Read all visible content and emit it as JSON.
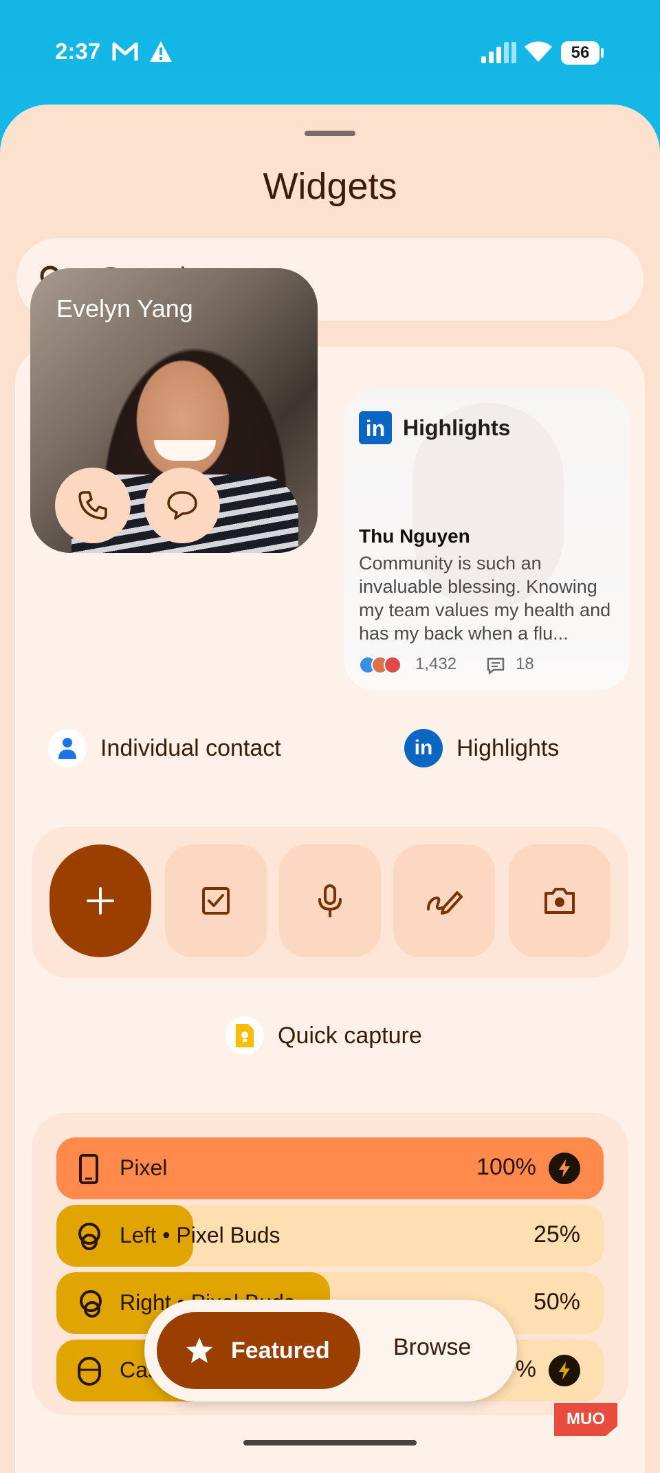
{
  "status_bar": {
    "time": "2:37",
    "battery": "56",
    "icons": [
      "gmail-icon",
      "alert-icon",
      "signal-icon",
      "wifi-icon",
      "battery-icon"
    ]
  },
  "sheet": {
    "title": "Widgets",
    "search": {
      "placeholder": "Search",
      "icon": "search-icon"
    }
  },
  "widgets": {
    "contact": {
      "name": "Evelyn Yang",
      "caption": "Individual contact",
      "actions": [
        "phone-icon",
        "message-icon"
      ]
    },
    "linkedin": {
      "logo": "in",
      "header": "Highlights",
      "author": "Thu Nguyen",
      "post": "Community is such an invaluable blessing. Knowing my team values my health and has my back when a flu...",
      "reactions": "1,432",
      "comments": "18",
      "caption": "Highlights"
    },
    "quick_capture": {
      "caption": "Quick capture",
      "buttons": [
        "add-icon",
        "checkbox-icon",
        "mic-icon",
        "draw-icon",
        "camera-icon"
      ]
    },
    "batteries": [
      {
        "label": "Pixel",
        "percent": "100%",
        "level": 1.0,
        "charging": true,
        "icon": "phone-icon"
      },
      {
        "label": "Left • Pixel Buds",
        "percent": "25%",
        "level": 0.25,
        "charging": false,
        "icon": "earbud-icon"
      },
      {
        "label": "Right • Pixel Buds",
        "percent": "50%",
        "level": 0.5,
        "charging": false,
        "icon": "earbud-icon"
      },
      {
        "label": "Case",
        "percent": "%",
        "level": 0.65,
        "charging": true,
        "icon": "case-icon"
      }
    ]
  },
  "tabs": {
    "featured": "Featured",
    "browse": "Browse"
  },
  "watermark": "MUO",
  "colors": {
    "accent": "#9b3f00",
    "sheet": "#fde1cf",
    "pixel_bar": "#ff8a4c",
    "buds_fill": "#e0a500",
    "linkedin": "#0a66c2"
  }
}
